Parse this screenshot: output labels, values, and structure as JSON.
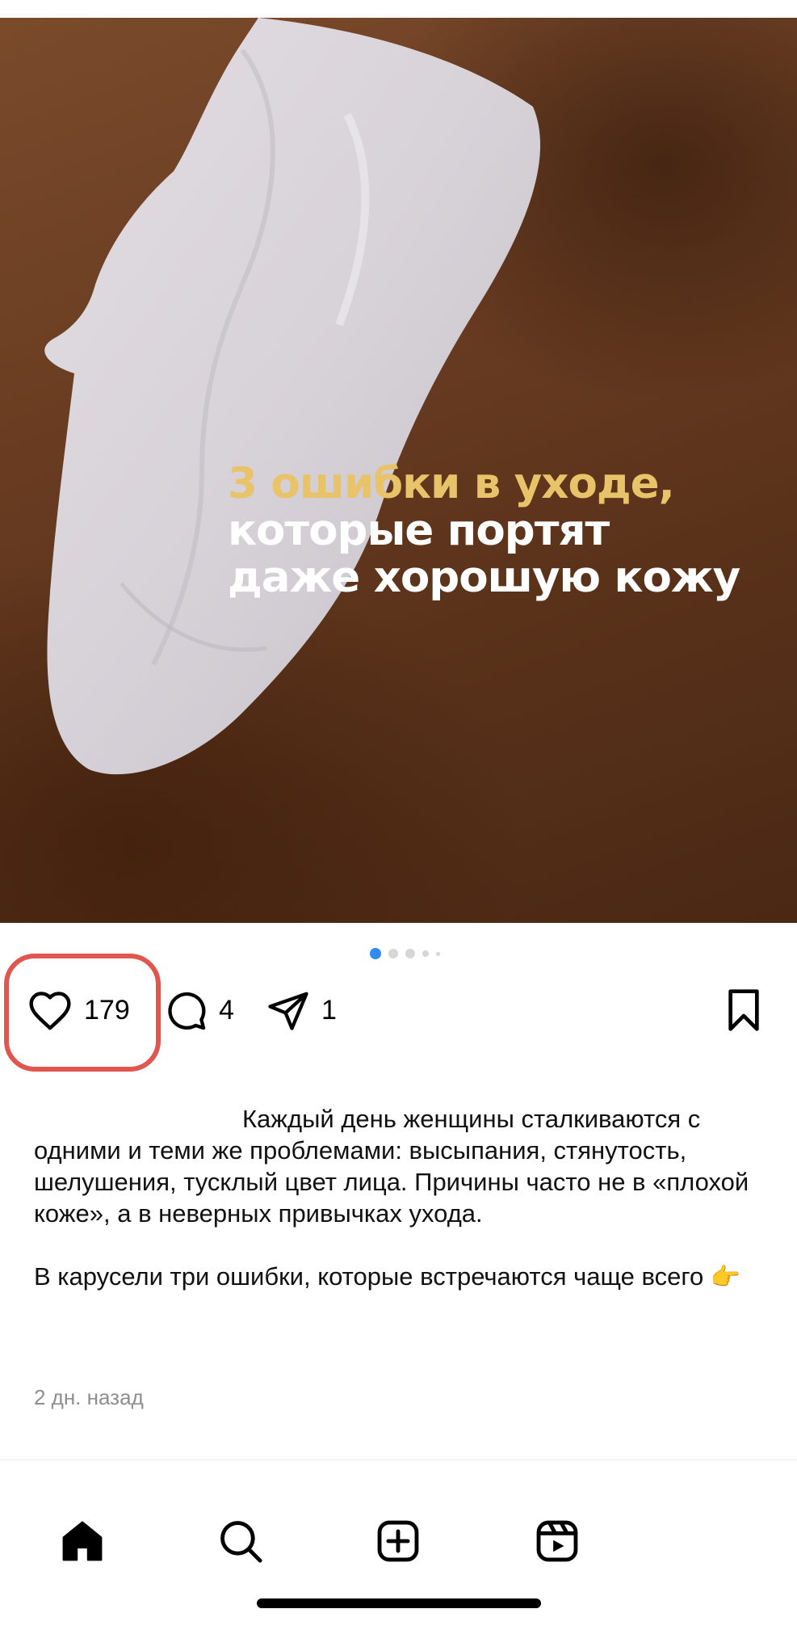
{
  "post": {
    "image_text": {
      "line1": "3 ошибки в уходе,",
      "line2": "которые портят",
      "line3": "даже хорошую кожу"
    },
    "carousel": {
      "total_dots": 5,
      "active_index": 0,
      "active_color": "#2f8cf0"
    },
    "actions": {
      "like_count": "179",
      "comment_count": "4",
      "share_count": "1"
    },
    "highlight_color": "#e0574f",
    "description": {
      "paragraph1": "Каждый день женщины сталкиваются с одними и теми же проблемами: высыпания, стянутость, шелушения, тусклый цвет лица. Причины часто не в «плохой коже», а в неверных привычках ухода.",
      "paragraph2": "В карусели три ошибки, которые встречаются чаще всего",
      "emoji": "👉"
    },
    "timestamp": "2 дн. назад"
  },
  "icons": {
    "like": "heart-icon",
    "comment": "comment-icon",
    "share": "paper-plane-icon",
    "save": "bookmark-icon"
  },
  "bottom_nav": {
    "items": [
      "home-icon",
      "search-icon",
      "create-icon",
      "reels-icon"
    ]
  }
}
